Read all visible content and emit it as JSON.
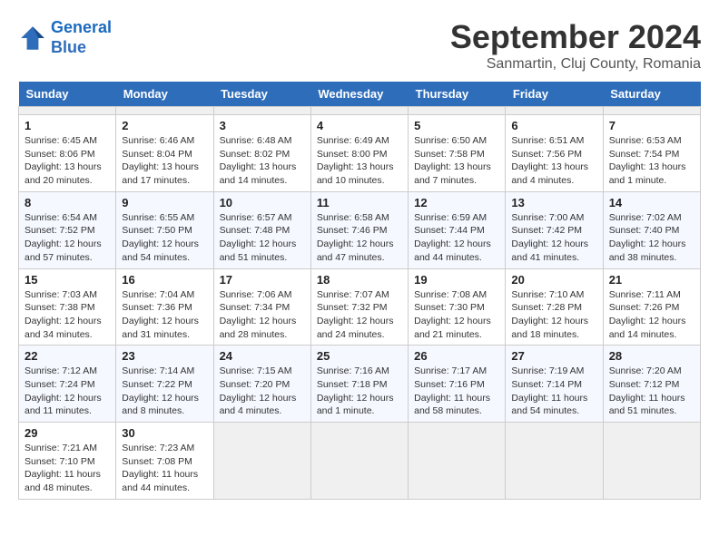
{
  "header": {
    "logo_line1": "General",
    "logo_line2": "Blue",
    "title": "September 2024",
    "subtitle": "Sanmartin, Cluj County, Romania"
  },
  "calendar": {
    "headers": [
      "Sunday",
      "Monday",
      "Tuesday",
      "Wednesday",
      "Thursday",
      "Friday",
      "Saturday"
    ],
    "weeks": [
      [
        {
          "num": "",
          "empty": true
        },
        {
          "num": "",
          "empty": true
        },
        {
          "num": "",
          "empty": true
        },
        {
          "num": "",
          "empty": true
        },
        {
          "num": "",
          "empty": true
        },
        {
          "num": "",
          "empty": true
        },
        {
          "num": "",
          "empty": true
        }
      ],
      [
        {
          "num": "1",
          "info": "Sunrise: 6:45 AM\nSunset: 8:06 PM\nDaylight: 13 hours\nand 20 minutes."
        },
        {
          "num": "2",
          "info": "Sunrise: 6:46 AM\nSunset: 8:04 PM\nDaylight: 13 hours\nand 17 minutes."
        },
        {
          "num": "3",
          "info": "Sunrise: 6:48 AM\nSunset: 8:02 PM\nDaylight: 13 hours\nand 14 minutes."
        },
        {
          "num": "4",
          "info": "Sunrise: 6:49 AM\nSunset: 8:00 PM\nDaylight: 13 hours\nand 10 minutes."
        },
        {
          "num": "5",
          "info": "Sunrise: 6:50 AM\nSunset: 7:58 PM\nDaylight: 13 hours\nand 7 minutes."
        },
        {
          "num": "6",
          "info": "Sunrise: 6:51 AM\nSunset: 7:56 PM\nDaylight: 13 hours\nand 4 minutes."
        },
        {
          "num": "7",
          "info": "Sunrise: 6:53 AM\nSunset: 7:54 PM\nDaylight: 13 hours\nand 1 minute."
        }
      ],
      [
        {
          "num": "8",
          "info": "Sunrise: 6:54 AM\nSunset: 7:52 PM\nDaylight: 12 hours\nand 57 minutes."
        },
        {
          "num": "9",
          "info": "Sunrise: 6:55 AM\nSunset: 7:50 PM\nDaylight: 12 hours\nand 54 minutes."
        },
        {
          "num": "10",
          "info": "Sunrise: 6:57 AM\nSunset: 7:48 PM\nDaylight: 12 hours\nand 51 minutes."
        },
        {
          "num": "11",
          "info": "Sunrise: 6:58 AM\nSunset: 7:46 PM\nDaylight: 12 hours\nand 47 minutes."
        },
        {
          "num": "12",
          "info": "Sunrise: 6:59 AM\nSunset: 7:44 PM\nDaylight: 12 hours\nand 44 minutes."
        },
        {
          "num": "13",
          "info": "Sunrise: 7:00 AM\nSunset: 7:42 PM\nDaylight: 12 hours\nand 41 minutes."
        },
        {
          "num": "14",
          "info": "Sunrise: 7:02 AM\nSunset: 7:40 PM\nDaylight: 12 hours\nand 38 minutes."
        }
      ],
      [
        {
          "num": "15",
          "info": "Sunrise: 7:03 AM\nSunset: 7:38 PM\nDaylight: 12 hours\nand 34 minutes."
        },
        {
          "num": "16",
          "info": "Sunrise: 7:04 AM\nSunset: 7:36 PM\nDaylight: 12 hours\nand 31 minutes."
        },
        {
          "num": "17",
          "info": "Sunrise: 7:06 AM\nSunset: 7:34 PM\nDaylight: 12 hours\nand 28 minutes."
        },
        {
          "num": "18",
          "info": "Sunrise: 7:07 AM\nSunset: 7:32 PM\nDaylight: 12 hours\nand 24 minutes."
        },
        {
          "num": "19",
          "info": "Sunrise: 7:08 AM\nSunset: 7:30 PM\nDaylight: 12 hours\nand 21 minutes."
        },
        {
          "num": "20",
          "info": "Sunrise: 7:10 AM\nSunset: 7:28 PM\nDaylight: 12 hours\nand 18 minutes."
        },
        {
          "num": "21",
          "info": "Sunrise: 7:11 AM\nSunset: 7:26 PM\nDaylight: 12 hours\nand 14 minutes."
        }
      ],
      [
        {
          "num": "22",
          "info": "Sunrise: 7:12 AM\nSunset: 7:24 PM\nDaylight: 12 hours\nand 11 minutes."
        },
        {
          "num": "23",
          "info": "Sunrise: 7:14 AM\nSunset: 7:22 PM\nDaylight: 12 hours\nand 8 minutes."
        },
        {
          "num": "24",
          "info": "Sunrise: 7:15 AM\nSunset: 7:20 PM\nDaylight: 12 hours\nand 4 minutes."
        },
        {
          "num": "25",
          "info": "Sunrise: 7:16 AM\nSunset: 7:18 PM\nDaylight: 12 hours\nand 1 minute."
        },
        {
          "num": "26",
          "info": "Sunrise: 7:17 AM\nSunset: 7:16 PM\nDaylight: 11 hours\nand 58 minutes."
        },
        {
          "num": "27",
          "info": "Sunrise: 7:19 AM\nSunset: 7:14 PM\nDaylight: 11 hours\nand 54 minutes."
        },
        {
          "num": "28",
          "info": "Sunrise: 7:20 AM\nSunset: 7:12 PM\nDaylight: 11 hours\nand 51 minutes."
        }
      ],
      [
        {
          "num": "29",
          "info": "Sunrise: 7:21 AM\nSunset: 7:10 PM\nDaylight: 11 hours\nand 48 minutes."
        },
        {
          "num": "30",
          "info": "Sunrise: 7:23 AM\nSunset: 7:08 PM\nDaylight: 11 hours\nand 44 minutes."
        },
        {
          "num": "",
          "empty": true
        },
        {
          "num": "",
          "empty": true
        },
        {
          "num": "",
          "empty": true
        },
        {
          "num": "",
          "empty": true
        },
        {
          "num": "",
          "empty": true
        }
      ]
    ]
  }
}
